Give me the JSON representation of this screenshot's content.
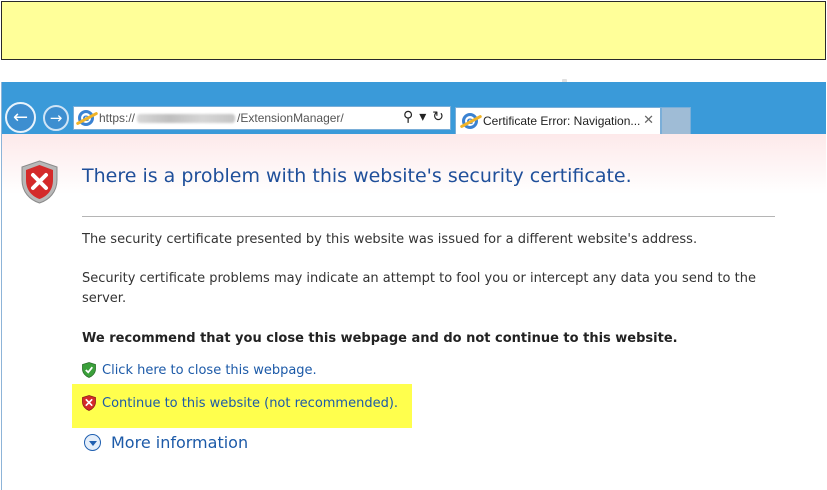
{
  "callout": {
    "text": ""
  },
  "browser": {
    "nav": {
      "back_icon": "back-arrow-icon",
      "forward_icon": "forward-arrow-icon"
    },
    "address": {
      "scheme": "https://",
      "path": "/ExtensionManager/",
      "search_glyph": "⚲",
      "dropdown_glyph": "▾",
      "refresh_glyph": "↻"
    },
    "tab": {
      "title": "Certificate Error: Navigation...",
      "close_glyph": "✕"
    }
  },
  "page": {
    "heading": "There is a problem with this website's security certificate.",
    "paragraph1": "The security certificate presented by this website was issued for a different website's address.",
    "paragraph2": "Security certificate problems may indicate an attempt to fool you or intercept any data you send to the server.",
    "recommendation": "We recommend that you close this webpage and do not continue to this website.",
    "close_link": "Click here to close this webpage.",
    "continue_link": "Continue to this website (not recommended).",
    "more_info": "More information"
  },
  "colors": {
    "toolbar": "#3a9ad9",
    "highlight": "#ffff4d",
    "link": "#1c5aa8",
    "heading": "#1f4f9a",
    "callout_bg": "#ffff99"
  }
}
